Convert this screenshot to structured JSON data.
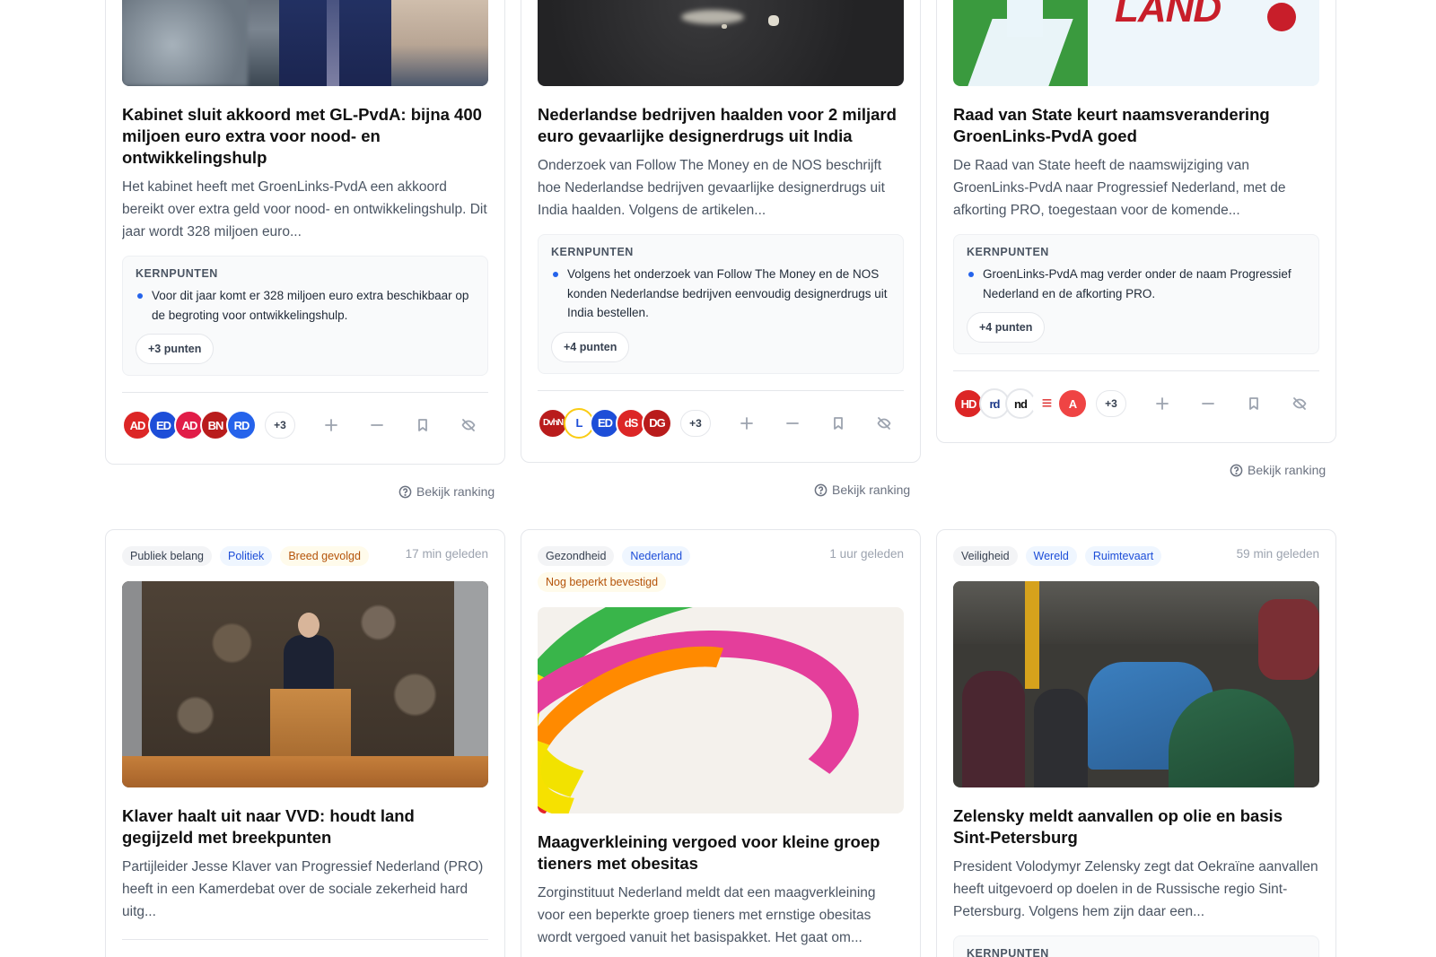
{
  "top_cards": [
    {
      "title": "Kabinet sluit akkoord met GL-PvdA: bijna 400 miljoen euro extra voor nood- en ontwikkelingshulp",
      "description": "Het kabinet heeft met GroenLinks-PvdA een akkoord bereikt over extra geld voor nood- en ontwikkelingshulp. Dit jaar wordt 328 miljoen euro...",
      "keypoints_heading": "KERNPUNTEN",
      "keypoint": "Voor dit jaar komt er 328 miljoen euro extra beschikbaar op de begroting voor ontwikkelingshulp.",
      "more_points": "+3 punten",
      "sources": [
        "AD",
        "ED",
        "AD",
        "BN",
        "RD"
      ],
      "sources_more": "+3",
      "ranking_label": "Bekijk ranking"
    },
    {
      "title": "Nederlandse bedrijven haalden voor 2 miljard euro gevaarlijke designerdrugs uit India",
      "description": "Onderzoek van Follow The Money en de NOS beschrijft hoe Nederlandse bedrijven gevaarlijke designerdrugs uit India haalden. Volgens de artikelen...",
      "keypoints_heading": "KERNPUNTEN",
      "keypoint": "Volgens het onderzoek van Follow The Money en de NOS konden Nederlandse bedrijven eenvoudig designerdrugs uit India bestellen.",
      "more_points": "+4 punten",
      "sources": [
        "DvhN",
        "L",
        "ED",
        "dS",
        "DG"
      ],
      "sources_more": "+3",
      "ranking_label": "Bekijk ranking"
    },
    {
      "title": "Raad van State keurt naamsverandering GroenLinks-PvdA goed",
      "description": "De Raad van State heeft de naamswijziging van GroenLinks-PvdA naar Progressief Nederland, met de afkorting PRO, toegestaan voor de komende...",
      "keypoints_heading": "KERNPUNTEN",
      "keypoint": "GroenLinks-PvdA mag verder onder de naam Progressief Nederland en de afkorting PRO.",
      "more_points": "+4 punten",
      "sources": [
        "HD",
        "rd",
        "nd",
        "≡",
        "A"
      ],
      "sources_more": "+3",
      "ranking_label": "Bekijk ranking"
    }
  ],
  "bottom_cards": [
    {
      "tags": [
        {
          "label": "Publiek belang",
          "style": "gray"
        },
        {
          "label": "Politiek",
          "style": "blue"
        },
        {
          "label": "Breed gevolgd",
          "style": "amber"
        }
      ],
      "time": "17 min geleden",
      "title": "Klaver haalt uit naar VVD: houdt land gegijzeld met breekpunten",
      "description": "Partijleider Jesse Klaver van Progressief Nederland (PRO) heeft in een Kamerdebat over de sociale zekerheid hard uitg..."
    },
    {
      "tags": [
        {
          "label": "Gezondheid",
          "style": "gray"
        },
        {
          "label": "Nederland",
          "style": "blue"
        },
        {
          "label": "Nog beperkt bevestigd",
          "style": "amber"
        }
      ],
      "time": "1 uur geleden",
      "title": "Maagverkleining vergoed voor kleine groep tieners met obesitas",
      "description": "Zorginstituut Nederland meldt dat een maagverkleining voor een beperkte groep tieners met ernstige obesitas wordt vergoed vanuit het basispakket. Het gaat om..."
    },
    {
      "tags": [
        {
          "label": "Veiligheid",
          "style": "gray"
        },
        {
          "label": "Wereld",
          "style": "blue"
        },
        {
          "label": "Ruimtevaart",
          "style": "blue"
        }
      ],
      "time": "59 min geleden",
      "title": "Zelensky meldt aanvallen op olie en basis Sint-Petersburg",
      "description": "President Volodymyr Zelensky zegt dat Oekraïne aanvallen heeft uitgevoerd op doelen in de Russische regio Sint-Petersburg. Volgens hem zijn daar een...",
      "keypoints_heading": "KERNPUNTEN"
    }
  ],
  "source_colors": [
    "#dc2626",
    "#1d4ed8",
    "#e11d48",
    "#b91c1c",
    "#2563eb"
  ],
  "accent_color": "#2563eb"
}
